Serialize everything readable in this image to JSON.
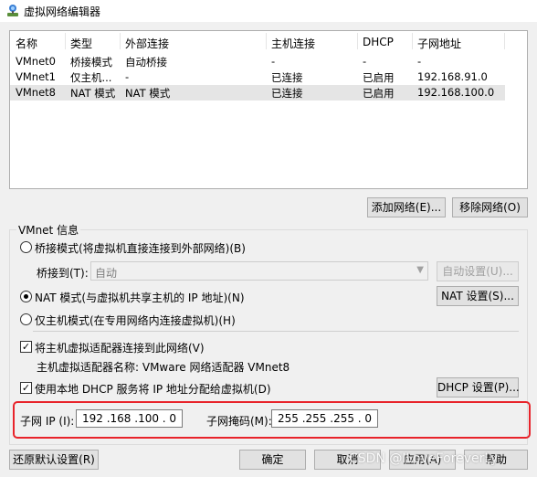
{
  "window": {
    "title": "虚拟网络编辑器",
    "icon": "vmware-network-icon"
  },
  "network_list": {
    "columns": [
      "名称",
      "类型",
      "外部连接",
      "主机连接",
      "DHCP",
      "子网地址"
    ],
    "rows": [
      {
        "name": "VMnet0",
        "type": "桥接模式",
        "external": "自动桥接",
        "host": "-",
        "dhcp": "-",
        "subnet": "-"
      },
      {
        "name": "VMnet1",
        "type": "仅主机...",
        "external": "-",
        "host": "已连接",
        "dhcp": "已启用",
        "subnet": "192.168.91.0"
      },
      {
        "name": "VMnet8",
        "type": "NAT 模式",
        "external": "NAT 模式",
        "host": "已连接",
        "dhcp": "已启用",
        "subnet": "192.168.100.0"
      }
    ],
    "selected_row": "VMnet8"
  },
  "list_buttons": {
    "add": "添加网络(E)...",
    "remove": "移除网络(O)"
  },
  "vmnet_info": {
    "group_label": "VMnet 信息",
    "bridge_radio": "桥接模式(将虚拟机直接连接到外部网络)(B)",
    "bridge_to_label": "桥接到(T):",
    "bridge_to_value": "自动",
    "auto_settings": "自动设置(U)...",
    "nat_radio": "NAT 模式(与虚拟机共享主机的 IP 地址)(N)",
    "nat_settings": "NAT 设置(S)...",
    "hostonly_radio": "仅主机模式(在专用网络内连接虚拟机)(H)",
    "selected_mode": "nat",
    "connect_adapter_check": "将主机虚拟适配器连接到此网络(V)",
    "adapter_name_label": "主机虚拟适配器名称: VMware 网络适配器 VMnet8",
    "dhcp_check": "使用本地 DHCP 服务将 IP 地址分配给虚拟机(D)",
    "dhcp_settings": "DHCP 设置(P)...",
    "subnet_ip_label": "子网 IP (I):",
    "subnet_ip": "192 .168 .100 . 0",
    "subnet_mask_label": "子网掩码(M):",
    "subnet_mask": "255 .255 .255 . 0",
    "highlight_color": "#e8232a"
  },
  "bottom_buttons": {
    "restore": "还原默认设置(R)",
    "ok": "确定",
    "cancel": "取消",
    "apply": "应用(A)",
    "help": "帮助"
  },
  "watermark": "CSDN @ILoveForeverLy"
}
